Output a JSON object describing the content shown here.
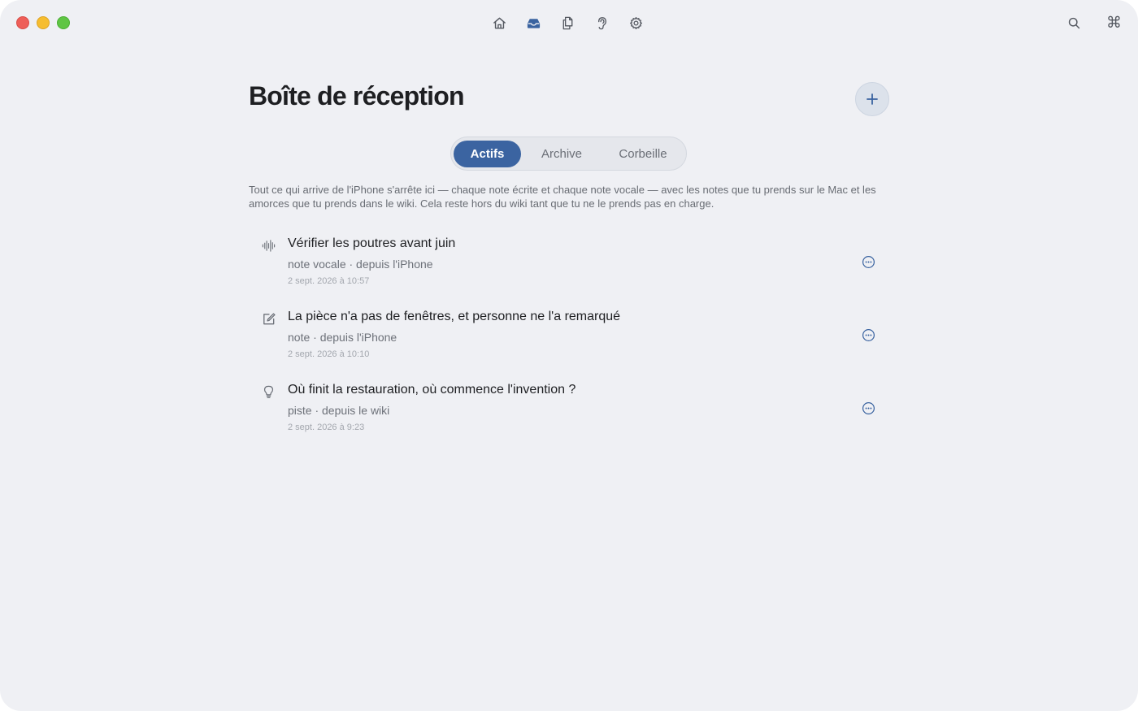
{
  "window": {
    "traffic_lights": [
      "close",
      "minimize",
      "zoom"
    ]
  },
  "toolbar": {
    "center": [
      {
        "icon": "house-icon",
        "label": "Accueil",
        "active": false
      },
      {
        "icon": "inbox-tray-icon",
        "label": "Boîte de réception",
        "active": true
      },
      {
        "icon": "documents-icon",
        "label": "Documents",
        "active": false
      },
      {
        "icon": "ear-icon",
        "label": "Écoute",
        "active": false
      },
      {
        "icon": "gear-icon",
        "label": "Réglages",
        "active": false
      }
    ],
    "right": [
      {
        "icon": "search-icon"
      },
      {
        "icon": "command-icon",
        "glyph": "⌘"
      }
    ]
  },
  "page": {
    "title": "Boîte de réception",
    "add_icon": "plus-icon"
  },
  "tabs": {
    "items": [
      "Actifs",
      "Archive",
      "Corbeille"
    ],
    "selected": "Actifs"
  },
  "intro": "Tout ce qui arrive de l'iPhone s'arrête ici — chaque note écrite et chaque note vocale — avec les notes que tu prends sur le Mac et les amorces que tu prends dans le wiki. Cela reste hors du wiki tant que tu ne le prends pas en charge.",
  "items": [
    {
      "icon": "waveform-icon",
      "title": "Vérifier les poutres avant juin",
      "meta": "note vocale · depuis l'iPhone",
      "date": "2 sept. 2026 à 10:57",
      "more_icon": "ellipsis-circle-icon"
    },
    {
      "icon": "compose-icon",
      "title": "La pièce n'a pas de fenêtres, et personne ne l'a remarqué",
      "meta": "note · depuis l'iPhone",
      "date": "2 sept. 2026 à 10:10",
      "more_icon": "ellipsis-circle-icon"
    },
    {
      "icon": "lightbulb-icon",
      "title": "Où finit la restauration, où commence l'invention ?",
      "meta": "piste · depuis le wiki",
      "date": "2 sept. 2026 à 9:23",
      "more_icon": "ellipsis-circle-icon"
    }
  ],
  "colors": {
    "background": "#eff0f4",
    "accent": "#3b64a1",
    "text": "#1e1f22",
    "secondary_text": "#6d7179"
  }
}
